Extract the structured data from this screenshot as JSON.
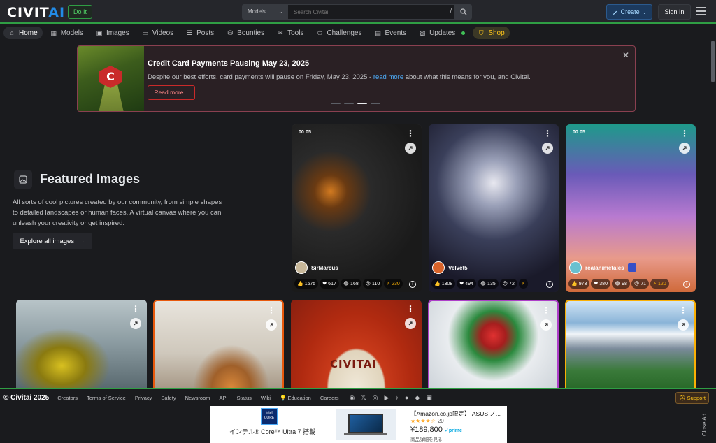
{
  "header": {
    "logo_main": "CIVIT",
    "logo_accent": "AI",
    "doit_label": "Do It",
    "search_category": "Models",
    "search_placeholder": "Search Civitai",
    "search_shortcut": "/",
    "create_label": "Create",
    "signin_label": "Sign In"
  },
  "nav": {
    "items": [
      {
        "label": "Home",
        "icon": "home-icon"
      },
      {
        "label": "Models",
        "icon": "models-icon"
      },
      {
        "label": "Images",
        "icon": "image-icon"
      },
      {
        "label": "Videos",
        "icon": "video-icon"
      },
      {
        "label": "Posts",
        "icon": "posts-icon"
      },
      {
        "label": "Bounties",
        "icon": "bounty-icon"
      },
      {
        "label": "Tools",
        "icon": "tools-icon"
      },
      {
        "label": "Challenges",
        "icon": "trophy-icon"
      },
      {
        "label": "Events",
        "icon": "calendar-icon"
      },
      {
        "label": "Updates",
        "icon": "updates-icon"
      },
      {
        "label": "Shop",
        "icon": "shop-icon"
      }
    ]
  },
  "banner": {
    "title": "Credit Card Payments Pausing May 23, 2025",
    "desc_before": "Despite our best efforts, card payments will pause on Friday, May 23, 2025 - ",
    "desc_link": "read more",
    "desc_after": " about what this means for you, and Civitai.",
    "button_label": "Read more..."
  },
  "featured": {
    "title": "Featured Images",
    "description": "All sorts of cool pictures created by our community, from simple shapes to detailed landscapes or human faces. A virtual canvas where you can unleash your creativity or get inspired.",
    "explore_label": "Explore all images"
  },
  "cards": [
    {
      "duration": "00:05",
      "user": "SirMarcus",
      "likes": "1675",
      "hearts": "617",
      "laugh": "168",
      "cry": "110",
      "buzz": "230"
    },
    {
      "duration": "",
      "user": "Velvet5",
      "likes": "1308",
      "hearts": "494",
      "laugh": "135",
      "cry": "72",
      "buzz": ""
    },
    {
      "duration": "00:05",
      "user": "realanimetales",
      "likes": "973",
      "hearts": "380",
      "laugh": "98",
      "cry": "71",
      "buzz": "120"
    }
  ],
  "footer": {
    "copyright": "© Civitai 2025",
    "links": [
      "Creators",
      "Terms of Service",
      "Privacy",
      "Safety",
      "Newsroom",
      "API",
      "Status",
      "Wiki",
      "💡 Education",
      "Careers"
    ],
    "support_label": "Support"
  },
  "ad": {
    "intel_label": "intel CORE",
    "text": "インテル® Core™ Ultra 7 搭載",
    "product": "【Amazon.co.jp限定】 ASUS ノ...",
    "rating_count": "20",
    "price": "¥189,800",
    "prime": "✓prime",
    "detail": "商品詳細を見る",
    "close_label": "Close Ad"
  }
}
